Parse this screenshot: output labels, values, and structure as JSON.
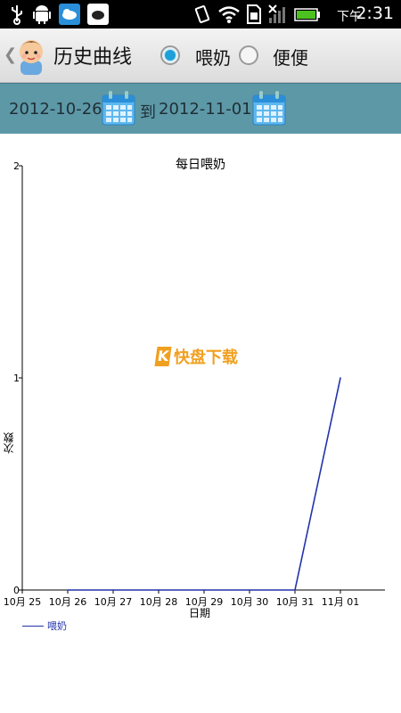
{
  "status_bar": {
    "ampm": "下午",
    "time": "2:31"
  },
  "header": {
    "title": "历史曲线",
    "options": [
      {
        "label": "喂奶",
        "selected": true
      },
      {
        "label": "便便",
        "selected": false
      }
    ]
  },
  "date_range": {
    "start": "2012-10-26",
    "separator": "到",
    "end": "2012-11-01"
  },
  "watermark": {
    "text": "快盘下载"
  },
  "chart_data": {
    "type": "line",
    "title": "每日喂奶",
    "xlabel": "日期",
    "ylabel": "次数",
    "categories": [
      "10月 25",
      "10月 26",
      "10月 27",
      "10月 28",
      "10月 29",
      "10月 30",
      "10月 31",
      "11月 01"
    ],
    "x": [
      "10月 26",
      "10月 27",
      "10月 28",
      "10月 29",
      "10月 30",
      "10月 31",
      "11月 01"
    ],
    "series": [
      {
        "name": "喂奶",
        "color": "#2233aa",
        "values": [
          0,
          0,
          0,
          0,
          0,
          0,
          1
        ]
      }
    ],
    "yticks": [
      "0",
      "1",
      "2"
    ],
    "ylim": [
      0,
      2
    ],
    "legend": "bottom-left",
    "grid": false
  }
}
